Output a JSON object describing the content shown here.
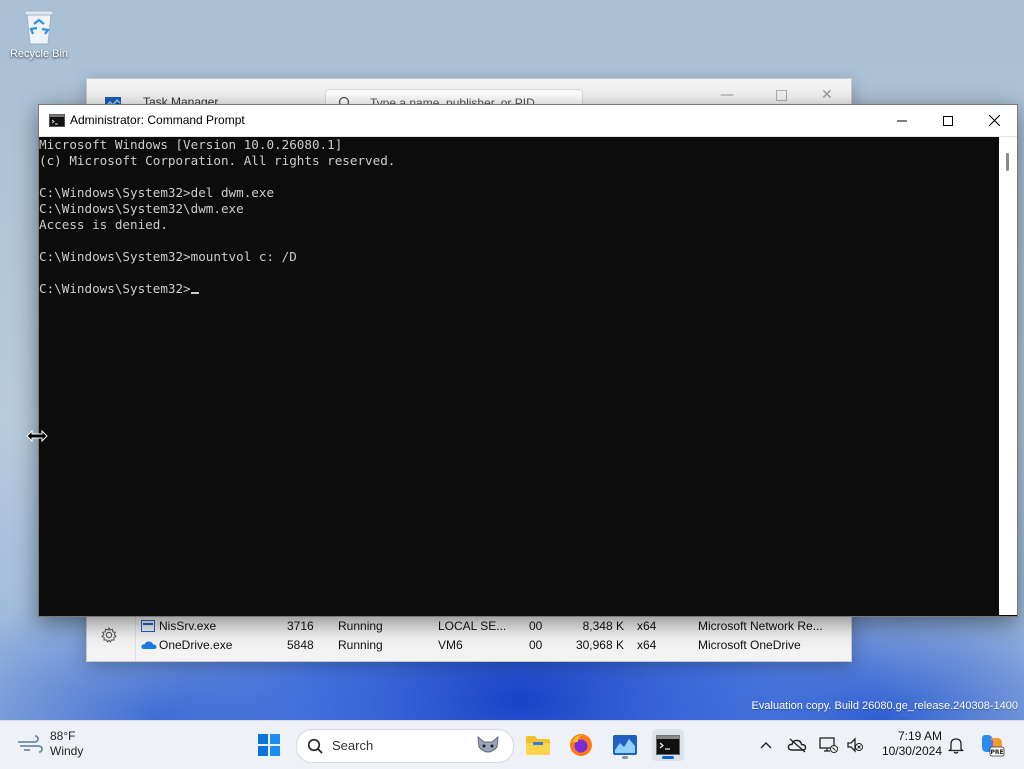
{
  "desktop": {
    "recycle_bin_label": "Recycle Bin",
    "watermark": "Evaluation copy. Build 26080.ge_release.240308-1400"
  },
  "task_manager": {
    "title": "Task Manager",
    "search_placeholder": "Type a name, publisher, or PID",
    "rows": [
      {
        "name": "NisSrv.exe",
        "pid": "3716",
        "status": "Running",
        "user": "LOCAL SE...",
        "cpu": "00",
        "memory": "8,348 K",
        "arch": "x64",
        "description": "Microsoft Network Re..."
      },
      {
        "name": "OneDrive.exe",
        "pid": "5848",
        "status": "Running",
        "user": "VM6",
        "cpu": "00",
        "memory": "30,968 K",
        "arch": "x64",
        "description": "Microsoft OneDrive"
      }
    ]
  },
  "cmd": {
    "title": "Administrator: Command Prompt",
    "lines": [
      "Microsoft Windows [Version 10.0.26080.1]",
      "(c) Microsoft Corporation. All rights reserved.",
      "",
      "C:\\Windows\\System32>del dwm.exe",
      "C:\\Windows\\System32\\dwm.exe",
      "Access is denied.",
      "",
      "C:\\Windows\\System32>mountvol c: /D",
      ""
    ],
    "prompt": "C:\\Windows\\System32>"
  },
  "taskbar": {
    "weather_temp": "88°F",
    "weather_desc": "Windy",
    "search_label": "Search",
    "time": "7:19 AM",
    "date": "10/30/2024"
  },
  "colors": {
    "console_bg": "#0c0c0c",
    "console_fg": "#cccccc",
    "accent": "#0a64d6"
  }
}
